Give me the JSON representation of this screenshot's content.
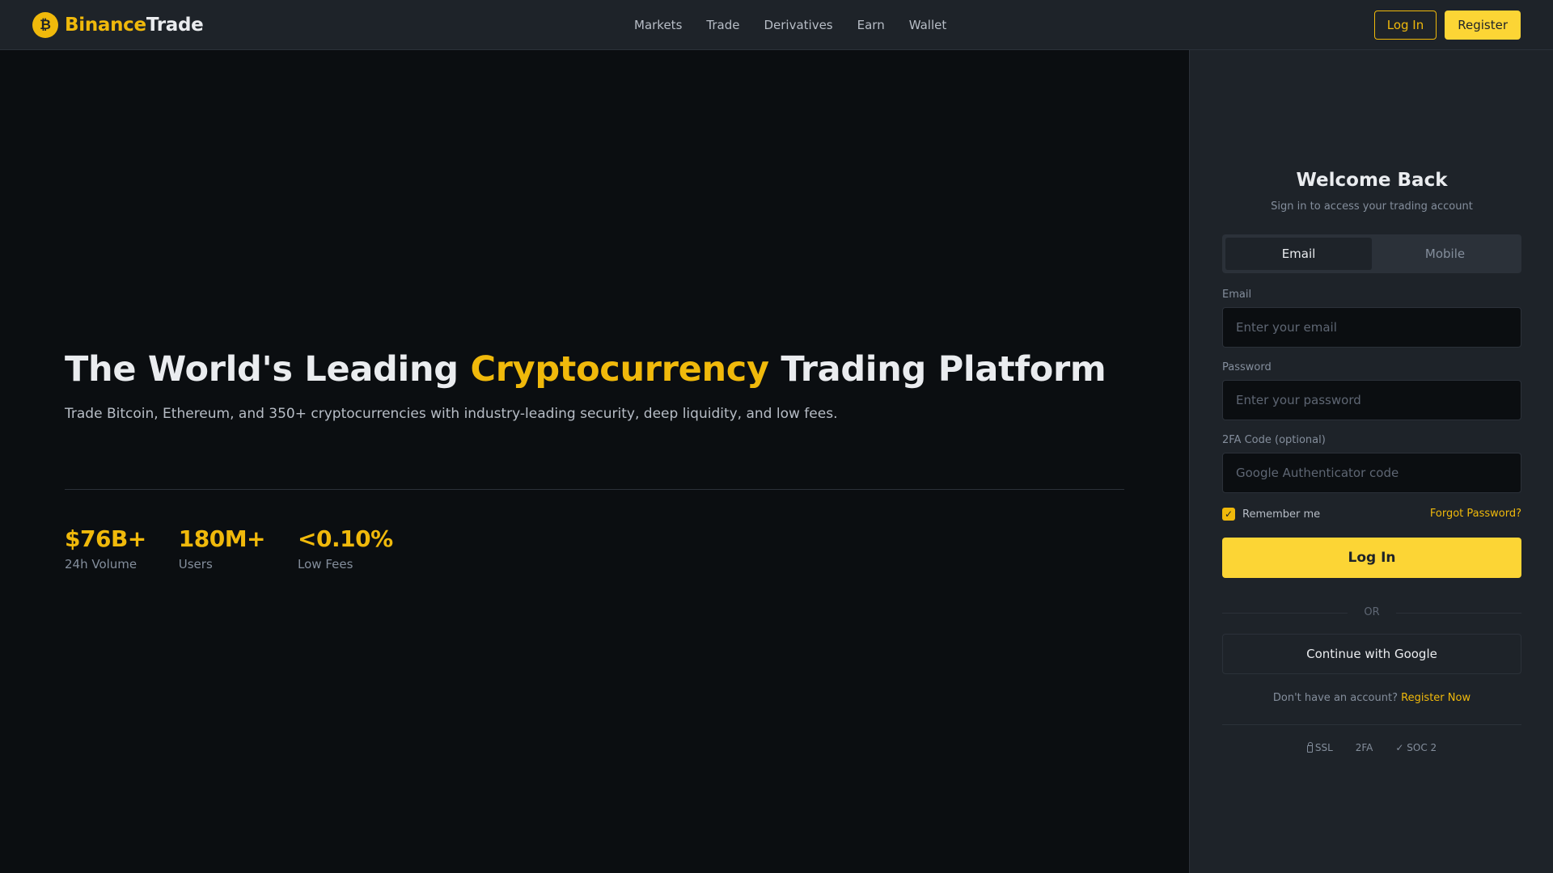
{
  "header": {
    "logo_symbol": "₿",
    "brand_part1": "Binance",
    "brand_part2": "Trade",
    "nav": [
      "Markets",
      "Trade",
      "Derivatives",
      "Earn",
      "Wallet"
    ],
    "login_label": "Log In",
    "register_label": "Register"
  },
  "hero": {
    "title_before": "The World's Leading ",
    "title_accent": "Cryptocurrency",
    "title_after": " Trading Platform",
    "subtitle": "Trade Bitcoin, Ethereum, and 350+ cryptocurrencies with industry-leading security, deep liquidity, and low fees.",
    "stats": [
      {
        "value": "$76B+",
        "label": "24h Volume"
      },
      {
        "value": "180M+",
        "label": "Users"
      },
      {
        "value": "<0.10%",
        "label": "Low Fees"
      }
    ]
  },
  "login": {
    "title": "Welcome Back",
    "subtitle": "Sign in to access your trading account",
    "tabs": [
      {
        "label": "Email",
        "active": true
      },
      {
        "label": "Mobile",
        "active": false
      }
    ],
    "email_label": "Email",
    "email_placeholder": "Enter your email",
    "password_label": "Password",
    "password_placeholder": "Enter your password",
    "twofa_label": "2FA Code (optional)",
    "twofa_placeholder": "Google Authenticator code",
    "remember_label": "Remember me",
    "remember_checked": true,
    "forgot_label": "Forgot Password?",
    "submit_label": "Log In",
    "or_label": "OR",
    "google_label": "Continue with Google",
    "signup_prompt": "Don't have an account?",
    "signup_link": "Register Now",
    "badges": [
      "SSL",
      "2FA",
      "✓ SOC 2"
    ]
  },
  "colors": {
    "accent": "#f0b90b",
    "button_yellow": "#fcd535",
    "background": "#0b0e11",
    "panel": "#1e2329"
  }
}
